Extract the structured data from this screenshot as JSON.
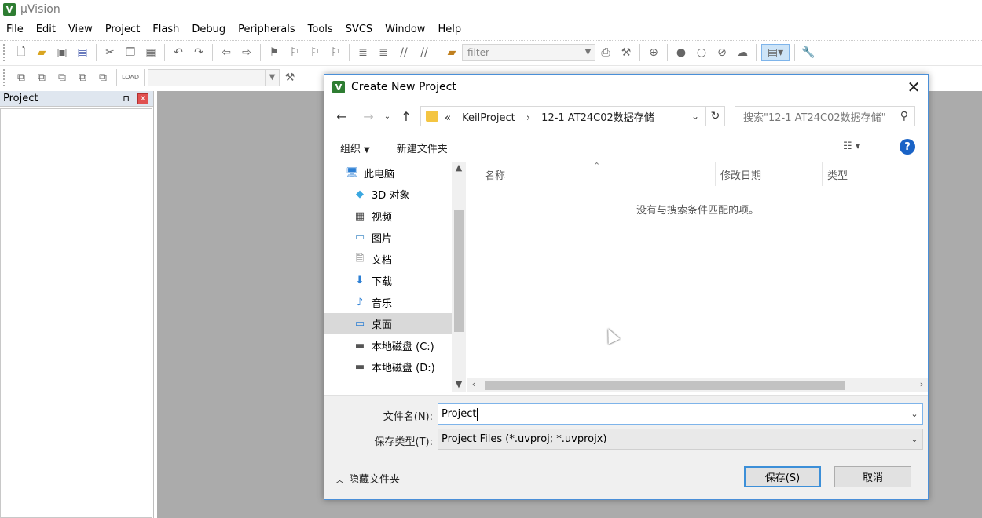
{
  "app": {
    "title": "µVision",
    "logo": "V"
  },
  "menu": [
    "File",
    "Edit",
    "View",
    "Project",
    "Flash",
    "Debug",
    "Peripherals",
    "Tools",
    "SVCS",
    "Window",
    "Help"
  ],
  "toolbar": {
    "filter_placeholder": "filter",
    "load_label": "LOAD"
  },
  "project_panel": {
    "title": "Project",
    "pin": "⊓",
    "close": "x"
  },
  "dialog": {
    "title": "Create New Project",
    "address": {
      "prefix": "«",
      "crumbs": [
        "KeilProject",
        "12-1 AT24C02数据存储"
      ]
    },
    "search_placeholder": "搜索\"12-1 AT24C02数据存储\"",
    "commands": {
      "organize": "组织",
      "new_folder": "新建文件夹"
    },
    "nav_items": [
      {
        "label": "此电脑",
        "icon": "computer-icon"
      },
      {
        "label": "3D 对象",
        "icon": "3d-objects-icon"
      },
      {
        "label": "视频",
        "icon": "video-icon"
      },
      {
        "label": "图片",
        "icon": "pictures-icon"
      },
      {
        "label": "文档",
        "icon": "documents-icon"
      },
      {
        "label": "下载",
        "icon": "download-icon"
      },
      {
        "label": "音乐",
        "icon": "music-icon"
      },
      {
        "label": "桌面",
        "icon": "desktop-icon",
        "selected": true
      },
      {
        "label": "本地磁盘 (C:)",
        "icon": "drive-c-icon"
      },
      {
        "label": "本地磁盘 (D:)",
        "icon": "drive-d-icon"
      }
    ],
    "columns": [
      "名称",
      "修改日期",
      "类型"
    ],
    "empty_message": "没有与搜索条件匹配的项。",
    "filename_label": "文件名(N):",
    "filename_value": "Project",
    "filetype_label": "保存类型(T):",
    "filetype_value": "Project Files (*.uvproj; *.uvprojx)",
    "hide_folders": "隐藏文件夹",
    "save_button": "保存(S)",
    "cancel_button": "取消"
  }
}
